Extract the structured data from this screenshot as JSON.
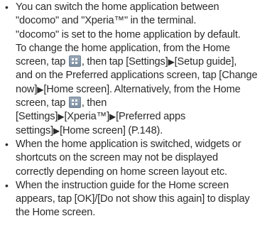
{
  "bullet_symbol": "•",
  "triangle_symbol": "▶",
  "items": [
    {
      "lines": [
        [
          "You can switch the home application between"
        ],
        [
          "\"docomo\" and \"Xperia™\" in the terminal."
        ],
        [
          "\"docomo\" is set to the home application by default."
        ],
        [
          "To change the home application, from the Home"
        ],
        [
          "screen, tap ",
          "{icon}",
          ", then tap [Settings]",
          "{tri}",
          "[Setup guide],"
        ],
        [
          "and on the Preferred applications screen, tap [Change"
        ],
        [
          "now]",
          "{tri}",
          "[Home screen]. Alternatively, from the Home"
        ],
        [
          "screen, tap ",
          "{icon}",
          ", then"
        ],
        [
          "[Settings]",
          "{tri}",
          "[Xperia™]",
          "{tri}",
          "[Preferred apps"
        ],
        [
          "settings]",
          "{tri}",
          "[Home screen] (P.148)."
        ]
      ]
    },
    {
      "lines": [
        [
          "When the home application is switched, widgets or"
        ],
        [
          "shortcuts on the screen may not be displayed"
        ],
        [
          "correctly depending on home screen layout etc."
        ]
      ]
    },
    {
      "lines": [
        [
          "When the instruction guide for the Home screen"
        ],
        [
          "appears, tap [OK]/[Do not show this again] to display"
        ],
        [
          "the Home screen."
        ]
      ]
    }
  ],
  "icons": {
    "home_apps_icon": "apps-grid-icon"
  },
  "colors": {
    "text": "#2b2b2b",
    "icon": "#8a9aab"
  }
}
